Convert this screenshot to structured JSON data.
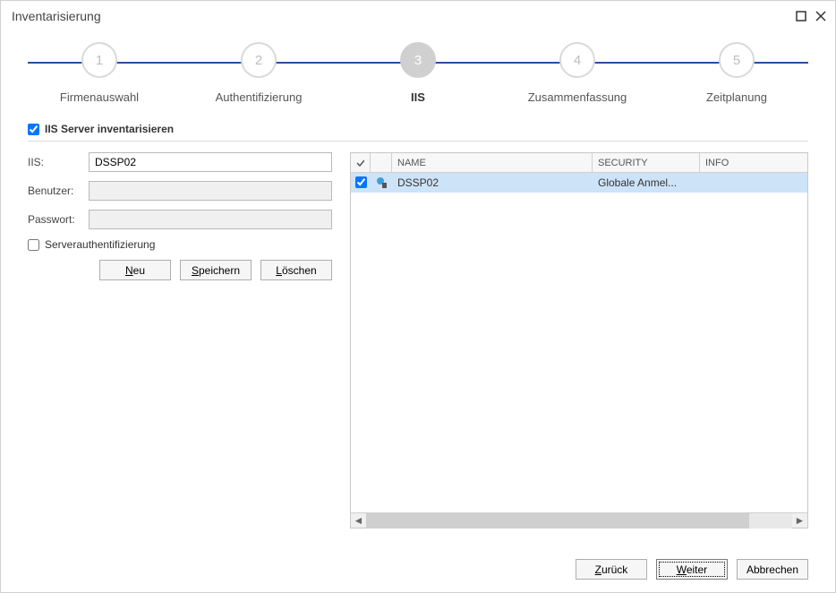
{
  "window_title": "Inventarisierung",
  "steps": [
    {
      "num": "1",
      "label": "Firmenauswahl"
    },
    {
      "num": "2",
      "label": "Authentifizierung"
    },
    {
      "num": "3",
      "label": "IIS"
    },
    {
      "num": "4",
      "label": "Zusammenfassung"
    },
    {
      "num": "5",
      "label": "Zeitplanung"
    }
  ],
  "active_step_index": 2,
  "inventory_checkbox_label": "IIS Server inventarisieren",
  "inventory_checked": true,
  "form": {
    "iis_label": "IIS:",
    "iis_value": "DSSP02",
    "user_label": "Benutzer:",
    "user_value": "",
    "pass_label": "Passwort:",
    "pass_value": "",
    "serverauth_label": "Serverauthentifizierung",
    "serverauth_checked": false
  },
  "buttons": {
    "new_prefix": "N",
    "new_rest": "eu",
    "save_prefix": "S",
    "save_rest": "peichern",
    "delete_prefix": "L",
    "delete_rest": "öschen",
    "back_prefix": "Z",
    "back_rest": "urück",
    "next_prefix": "W",
    "next_rest": "eiter",
    "cancel": "Abbrechen"
  },
  "table": {
    "headers": {
      "name": "NAME",
      "security": "SECURITY",
      "info": "INFO"
    },
    "rows": [
      {
        "checked": true,
        "name": "DSSP02",
        "security": "Globale Anmel...",
        "info": ""
      }
    ]
  }
}
